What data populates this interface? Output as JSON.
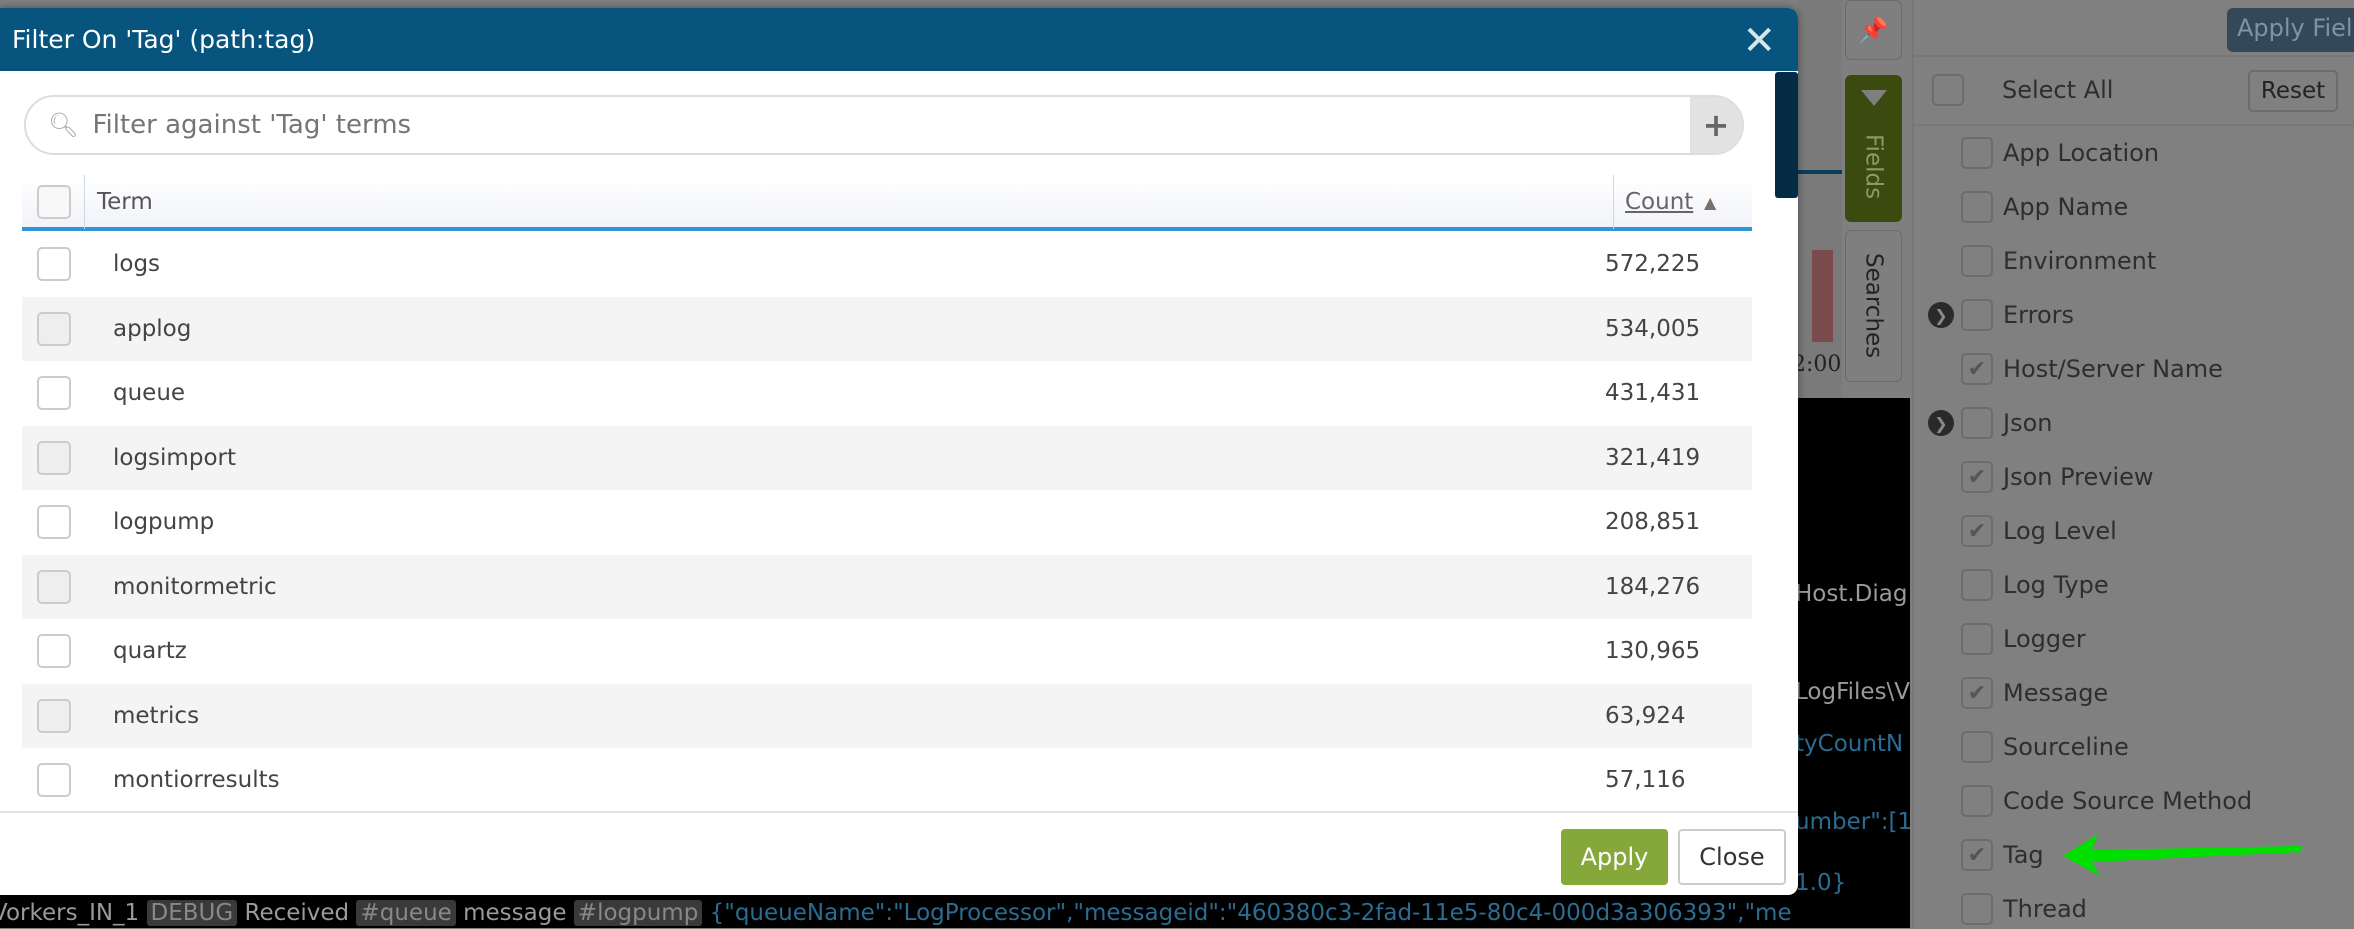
{
  "modal": {
    "title": "Filter On 'Tag' (path:tag)",
    "close_icon": "close-icon",
    "search": {
      "placeholder": "Filter against 'Tag' terms",
      "value": ""
    },
    "columns": {
      "term": "Term",
      "count": "Count"
    },
    "sort": "ascending",
    "rows": [
      {
        "term": "logs",
        "count": "572,225"
      },
      {
        "term": "applog",
        "count": "534,005"
      },
      {
        "term": "queue",
        "count": "431,431"
      },
      {
        "term": "logsimport",
        "count": "321,419"
      },
      {
        "term": "logpump",
        "count": "208,851"
      },
      {
        "term": "monitormetric",
        "count": "184,276"
      },
      {
        "term": "quartz",
        "count": "130,965"
      },
      {
        "term": "metrics",
        "count": "63,924"
      },
      {
        "term": "montiorresults",
        "count": "57,116"
      }
    ],
    "apply_label": "Apply",
    "close_label": "Close",
    "colors": {
      "header": "#07557f",
      "apply": "#86a83a",
      "accent": "#2d96d6"
    }
  },
  "side_tabs": {
    "fields": "Fields",
    "searches": "Searches",
    "chart_tick": "2:00"
  },
  "fields_panel": {
    "apply_label": "Apply Fiel",
    "select_all": "Select All",
    "reset_label": "Reset",
    "items": [
      {
        "label": "App Location",
        "checked": false,
        "expandable": false
      },
      {
        "label": "App Name",
        "checked": false,
        "expandable": false
      },
      {
        "label": "Environment",
        "checked": false,
        "expandable": false
      },
      {
        "label": "Errors",
        "checked": false,
        "expandable": true
      },
      {
        "label": "Host/Server Name",
        "checked": true,
        "expandable": false
      },
      {
        "label": "Json",
        "checked": false,
        "expandable": true
      },
      {
        "label": "Json Preview",
        "checked": true,
        "expandable": false
      },
      {
        "label": "Log Level",
        "checked": true,
        "expandable": false
      },
      {
        "label": "Log Type",
        "checked": false,
        "expandable": false
      },
      {
        "label": "Logger",
        "checked": false,
        "expandable": false
      },
      {
        "label": "Message",
        "checked": true,
        "expandable": false
      },
      {
        "label": "Sourceline",
        "checked": false,
        "expandable": false
      },
      {
        "label": "Code Source Method",
        "checked": false,
        "expandable": false
      },
      {
        "label": "Tag",
        "checked": true,
        "expandable": false
      },
      {
        "label": "Thread",
        "checked": false,
        "expandable": false
      }
    ]
  },
  "log": {
    "fragments": [
      "Host.Diag",
      "LogFiles\\V",
      "tyCountN",
      "umber\":[1",
      "1.0}"
    ],
    "line": {
      "thread": "Vorkers_IN_1",
      "level": "DEBUG",
      "text1": "Received",
      "tag1": "#queue",
      "text2": "message",
      "tag2": "#logpump",
      "json": "{\"queueName\":\"LogProcessor\",\"messageid\":\"460380c3-2fad-11e5-80c4-000d3a306393\",\"me"
    }
  }
}
